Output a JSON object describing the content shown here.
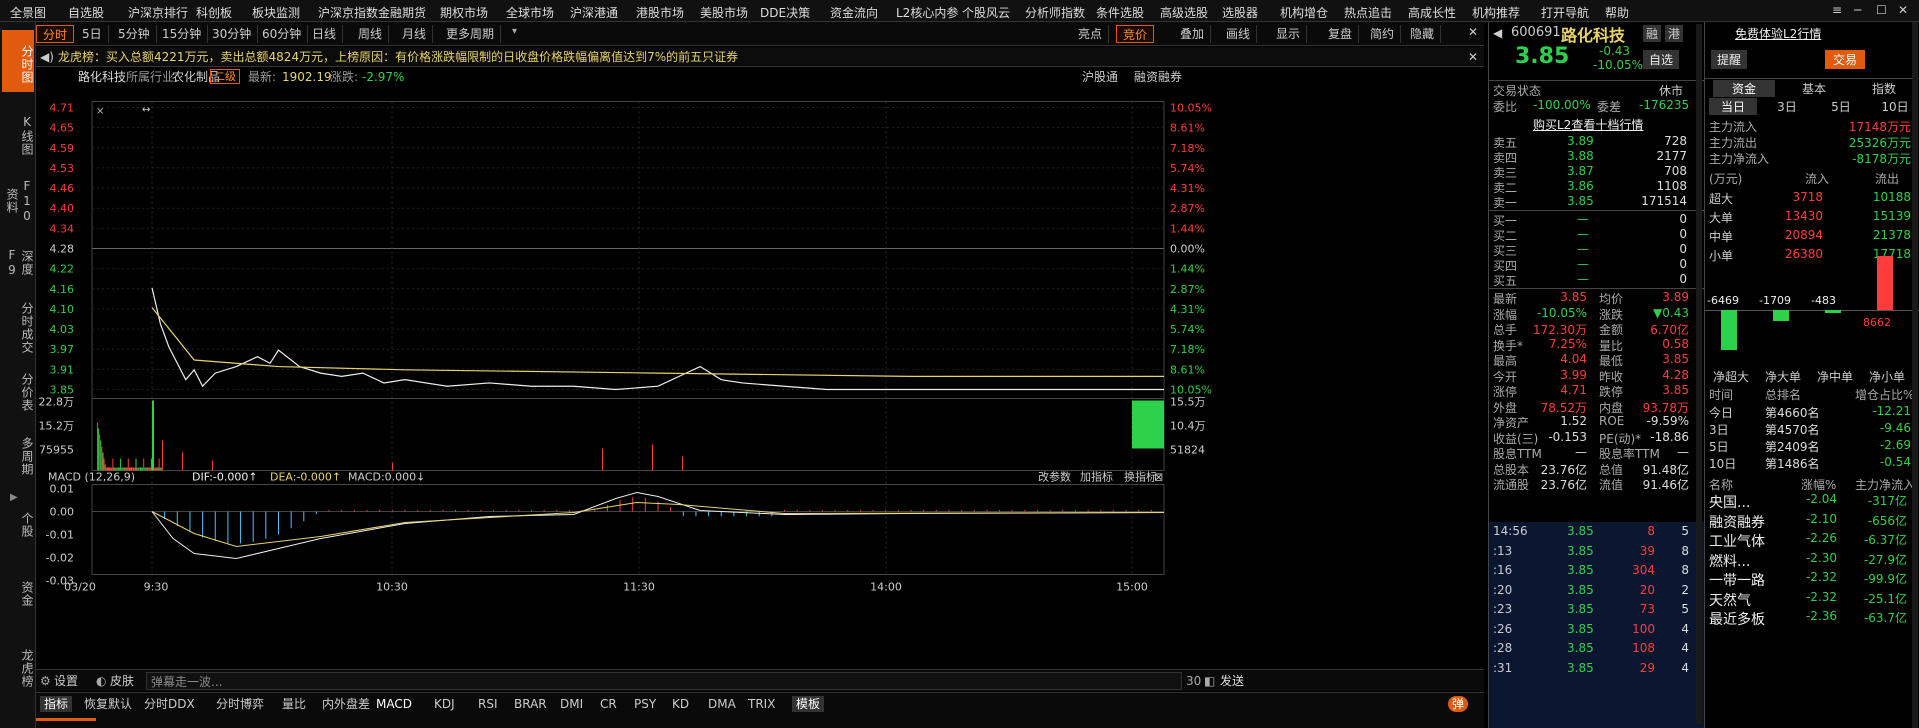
{
  "top_menu": [
    "全景图",
    "自选股",
    "沪深京排行",
    "科创板",
    "板块监测",
    "沪深京指数",
    "金融期货",
    "期权市场",
    "全球市场",
    "沪深港通",
    "港股市场",
    "美股市场",
    "DDE决策",
    "资金流向",
    "L2核心内参",
    "个股风云",
    "分析师指数",
    "条件选股",
    "高级选股",
    "选股器",
    "机构增仓",
    "热点追击",
    "高成长性",
    "机构推荐",
    "打开导航",
    "帮助"
  ],
  "left_tabs": [
    "分时图",
    "K线图",
    "F10资料",
    "深度F9",
    "分时成交",
    "分价表",
    "多周期",
    "个股",
    "资金",
    "龙虎榜"
  ],
  "toolbar": {
    "periods": [
      "分时",
      "5日",
      "5分钟",
      "15分钟",
      "30分钟",
      "60分钟",
      "日线",
      "周线",
      "月线",
      "更多周期"
    ],
    "right": [
      "亮点",
      "竞价",
      "叠加",
      "画线",
      "显示",
      "复盘",
      "简约",
      "隐藏"
    ]
  },
  "notice": "龙虎榜：买入总额4221万元，卖出总额4824万元，上榜原因：有价格涨跌幅限制的日收盘价格跌幅偏离值达到7%的前五只证券",
  "info": {
    "name": "路化科技",
    "industry_label": "所属行业:",
    "industry": "农化制品",
    "level": "二级",
    "latest_label": "最新:",
    "latest": "1902.19",
    "change_label": "涨跌:",
    "change": "-2.97%",
    "tags": [
      "沪股通",
      "融资融券"
    ]
  },
  "chart_data": [
    {
      "type": "line",
      "title": "",
      "x_ticks": [
        "03/20",
        "9:30",
        "10:30",
        "11:30",
        "14:00",
        "15:00"
      ],
      "ylim": [
        3.85,
        4.71
      ],
      "y_ticks_left": [
        "4.71",
        "4.65",
        "4.59",
        "4.53",
        "4.46",
        "4.40",
        "4.34",
        "4.28",
        "4.22",
        "4.16",
        "4.10",
        "4.03",
        "3.97",
        "3.91",
        "3.85"
      ],
      "y_ticks_right": [
        "10.05%",
        "8.61%",
        "7.18%",
        "5.74%",
        "4.31%",
        "2.87%",
        "1.44%",
        "0.00%",
        "1.44%",
        "2.87%",
        "4.31%",
        "5.74%",
        "7.18%",
        "8.61%",
        "10.05%"
      ],
      "prev_close": 4.28,
      "series": [
        {
          "name": "价格",
          "x": [
            0,
            2,
            4,
            6,
            8,
            10,
            12,
            15,
            20,
            25,
            28,
            30,
            35,
            40,
            45,
            50,
            55,
            60,
            70,
            80,
            90,
            100,
            110,
            120,
            125,
            130,
            135,
            140,
            150,
            160,
            170,
            180,
            190,
            200,
            210,
            220,
            230,
            240
          ],
          "values": [
            4.16,
            4.05,
            3.98,
            3.93,
            3.88,
            3.91,
            3.86,
            3.9,
            3.92,
            3.95,
            3.93,
            3.97,
            3.92,
            3.9,
            3.89,
            3.9,
            3.87,
            3.88,
            3.86,
            3.87,
            3.86,
            3.86,
            3.85,
            3.86,
            3.89,
            3.92,
            3.88,
            3.87,
            3.86,
            3.85,
            3.85,
            3.85,
            3.85,
            3.85,
            3.85,
            3.85,
            3.85,
            3.85
          ]
        },
        {
          "name": "均价",
          "x": [
            0,
            10,
            30,
            60,
            120,
            180,
            240
          ],
          "values": [
            4.1,
            3.94,
            3.92,
            3.91,
            3.9,
            3.89,
            3.89
          ]
        }
      ]
    },
    {
      "type": "bar",
      "title": "",
      "y_ticks_left": [
        "22.8万",
        "15.2万",
        "75955"
      ],
      "y_ticks_right": [
        "15.5万",
        "10.4万",
        "51824"
      ],
      "ylim": [
        0,
        228000
      ]
    },
    {
      "type": "bar",
      "title": "MACD",
      "legend": [
        "MACD (12,26,9)",
        "DIF:-0.000↑",
        "DEA:-0.000↑",
        "MACD:0.000↓"
      ],
      "y_ticks": [
        "0.01",
        "0.00",
        "-0.01",
        "-0.02",
        "-0.03"
      ],
      "ylim": [
        -0.032,
        0.012
      ]
    }
  ],
  "macd_tools": [
    "改参数",
    "加指标",
    "换指标"
  ],
  "bottom1": {
    "settings": "设置",
    "skin": "皮肤",
    "danmu": "弹幕走一波...",
    "count": "30",
    "send": "发送"
  },
  "bottom2": {
    "items": [
      "指标",
      "恢复默认",
      "分时DDX",
      "分时博弈",
      "量比",
      "内外盘差",
      "MACD",
      "KDJ",
      "RSI",
      "BRAR",
      "DMI",
      "CR",
      "PSY",
      "KD",
      "DMA",
      "TRIX",
      "模板"
    ],
    "toggle": "弹"
  },
  "quote": {
    "code": "600691",
    "name": "路化科技",
    "price": "3.85",
    "change": "-0.43",
    "pct": "-10.05%",
    "free_l2": "免费体验L2行情",
    "zixuan": "自选",
    "tixing": "提醒",
    "jiaoyi": "交易",
    "badges": [
      "融",
      "港"
    ],
    "status_label": "交易状态",
    "status": "休市",
    "weibi_label": "委比",
    "weibi": "-100.00%",
    "weicha_label": "委差",
    "weicha": "-176235",
    "buy_l2": "购买L2查看十档行情",
    "sells": [
      {
        "l": "卖五",
        "p": "3.89",
        "v": "728"
      },
      {
        "l": "卖四",
        "p": "3.88",
        "v": "2177"
      },
      {
        "l": "卖三",
        "p": "3.87",
        "v": "708"
      },
      {
        "l": "卖二",
        "p": "3.86",
        "v": "1108"
      },
      {
        "l": "卖一",
        "p": "3.85",
        "v": "171514"
      }
    ],
    "buys": [
      {
        "l": "买一",
        "p": "—",
        "v": "0"
      },
      {
        "l": "买二",
        "p": "—",
        "v": "0"
      },
      {
        "l": "买三",
        "p": "—",
        "v": "0"
      },
      {
        "l": "买四",
        "p": "—",
        "v": "0"
      },
      {
        "l": "买五",
        "p": "—",
        "v": "0"
      }
    ],
    "stats": [
      [
        "最新",
        "3.85",
        "均价",
        "3.89"
      ],
      [
        "涨幅",
        "-10.05%",
        "涨跌",
        "▼0.43"
      ],
      [
        "总手",
        "172.30万",
        "金额",
        "6.70亿"
      ],
      [
        "换手*",
        "7.25%",
        "量比",
        "0.58"
      ],
      [
        "最高",
        "4.04",
        "最低",
        "3.85"
      ],
      [
        "今开",
        "3.99",
        "昨收",
        "4.28"
      ],
      [
        "涨停",
        "4.71",
        "跌停",
        "3.85"
      ],
      [
        "外盘",
        "78.52万",
        "内盘",
        "93.78万"
      ],
      [
        "净资产",
        "1.52",
        "ROE",
        "-9.59%"
      ],
      [
        "收益(三)",
        "-0.153",
        "PE(动)*",
        "-18.86"
      ],
      [
        "股息TTM",
        "—",
        "股息率TTM",
        "—"
      ],
      [
        "总股本",
        "23.76亿",
        "总值",
        "91.48亿"
      ],
      [
        "流通股",
        "23.76亿",
        "流值",
        "91.46亿"
      ]
    ],
    "ticks": [
      [
        "14:56",
        "3.85",
        "8",
        "5"
      ],
      [
        ":13",
        "3.85",
        "39",
        "8"
      ],
      [
        ":16",
        "3.85",
        "304",
        "8"
      ],
      [
        ":20",
        "3.85",
        "20",
        "2"
      ],
      [
        ":23",
        "3.85",
        "73",
        "5"
      ],
      [
        ":26",
        "3.85",
        "100",
        "4"
      ],
      [
        ":28",
        "3.85",
        "108",
        "4"
      ],
      [
        ":31",
        "3.85",
        "29",
        "4"
      ]
    ]
  },
  "funds": {
    "tabs": [
      "资金",
      "基本",
      "指数"
    ],
    "period_tabs": [
      "当日",
      "3日",
      "5日",
      "10日"
    ],
    "main": [
      [
        "主力流入",
        "17148万元"
      ],
      [
        "主力流出",
        "25326万元"
      ],
      [
        "主力净流入",
        "-8178万元"
      ]
    ],
    "table_head": [
      "(万元)",
      "流入",
      "流出"
    ],
    "rows": [
      [
        "超大",
        "3718",
        "10188"
      ],
      [
        "大单",
        "13430",
        "15139"
      ],
      [
        "中单",
        "20894",
        "21378"
      ],
      [
        "小单",
        "26380",
        "17718"
      ]
    ],
    "net_values": [
      "-6469",
      "-1709",
      "-483",
      "8662"
    ],
    "net_labels": [
      "净超大",
      "净大单",
      "净中单",
      "净小单"
    ],
    "rank_head": [
      "时间",
      "总排名",
      "增仓占比%"
    ],
    "rank": [
      [
        "今日",
        "第4660名",
        "-12.21"
      ],
      [
        "3日",
        "第4570名",
        "-9.46"
      ],
      [
        "5日",
        "第2409名",
        "-2.69"
      ],
      [
        "10日",
        "第1486名",
        "-0.54"
      ]
    ],
    "sector_head": [
      "名称",
      "涨幅%",
      "主力净流入"
    ],
    "sectors": [
      [
        "央国...",
        "-2.04",
        "-317亿"
      ],
      [
        "融资融券",
        "-2.10",
        "-656亿"
      ],
      [
        "工业气体",
        "-2.26",
        "-6.37亿"
      ],
      [
        "燃料...",
        "-2.30",
        "-27.9亿"
      ],
      [
        "一带一路",
        "-2.32",
        "-99.9亿"
      ],
      [
        "天然气",
        "-2.32",
        "-25.1亿"
      ],
      [
        "最近多板",
        "-2.36",
        "-63.7亿"
      ]
    ]
  },
  "colors": {
    "accent": "#e05a10",
    "up": "#ff3b3b",
    "down": "#2ed14a",
    "avg": "#e8d36a"
  }
}
